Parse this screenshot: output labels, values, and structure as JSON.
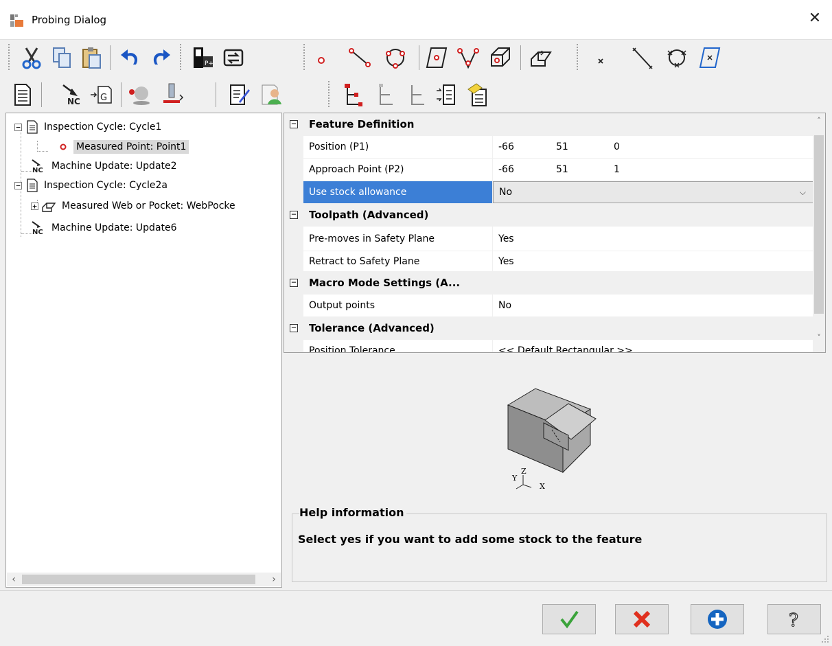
{
  "window": {
    "title": "Probing Dialog",
    "close_glyph": "✕"
  },
  "toolbar1": {
    "buttons": [
      "cut-icon",
      "copy-icon",
      "paste-icon",
      "undo-icon",
      "redo-icon",
      "probe-p-icon",
      "transfer-icon",
      "point-icon",
      "line-icon",
      "circle-icon",
      "plane-icon",
      "angle-icon",
      "cylinder-icon",
      "pocket-icon",
      "cross-point-icon",
      "cross-line-icon",
      "cross-circle-icon",
      "cross-plane-icon"
    ]
  },
  "toolbar2": {
    "buttons": [
      "document-icon",
      "nc-icon",
      "gcode-icon",
      "probe-sphere-icon",
      "tool-icon",
      "edit-note-icon",
      "user-icon",
      "tree-red-icon",
      "tree-gray-icon",
      "tree-light-icon",
      "list-icon",
      "tag-icon"
    ]
  },
  "tree": {
    "items": [
      {
        "label": "Inspection Cycle: Cycle1",
        "icon": "document-icon",
        "expander": "⊟"
      },
      {
        "label": "Measured Point: Point1",
        "icon": "point-icon",
        "selected": true
      },
      {
        "label": "Machine Update: Update2",
        "icon": "nc-icon"
      },
      {
        "label": "Inspection Cycle: Cycle2a",
        "icon": "document-icon",
        "expander": "⊟"
      },
      {
        "label": "Measured Web or Pocket: WebPocke",
        "icon": "pocket-icon",
        "expander": "⊞"
      },
      {
        "label": "Machine Update: Update6",
        "icon": "nc-icon"
      }
    ]
  },
  "grid": {
    "rows": [
      {
        "type": "category",
        "name": "Feature Definition",
        "toggle": "−"
      },
      {
        "type": "prop",
        "name": "Position (P1)",
        "coords": [
          "-66",
          "51",
          "0"
        ]
      },
      {
        "type": "prop",
        "name": "Approach Point (P2)",
        "coords": [
          "-66",
          "51",
          "1"
        ]
      },
      {
        "type": "prop",
        "name": "Use stock allowance",
        "value": "No",
        "selected": true
      },
      {
        "type": "category",
        "name": "Toolpath (Advanced)",
        "toggle": "−"
      },
      {
        "type": "prop",
        "name": "Pre-moves in Safety Plane",
        "value": "Yes"
      },
      {
        "type": "prop",
        "name": "Retract to Safety Plane",
        "value": "Yes"
      },
      {
        "type": "category",
        "name": "Macro Mode Settings (A...",
        "toggle": "−"
      },
      {
        "type": "prop",
        "name": "Output points",
        "value": "No"
      },
      {
        "type": "category",
        "name": "Tolerance (Advanced)",
        "toggle": "−"
      },
      {
        "type": "prop",
        "name": "Position Tolerance",
        "value": "<< Default Rectangular >>"
      }
    ]
  },
  "preview": {
    "axes": {
      "x": "X",
      "y": "Y",
      "z": "Z"
    }
  },
  "help": {
    "title": "Help information",
    "text": "Select yes if you want to add some stock to the feature"
  },
  "buttons": {
    "ok": "ok-check-icon",
    "cancel": "cancel-x-icon",
    "add": "add-plus-icon",
    "help": "help-question-icon"
  }
}
